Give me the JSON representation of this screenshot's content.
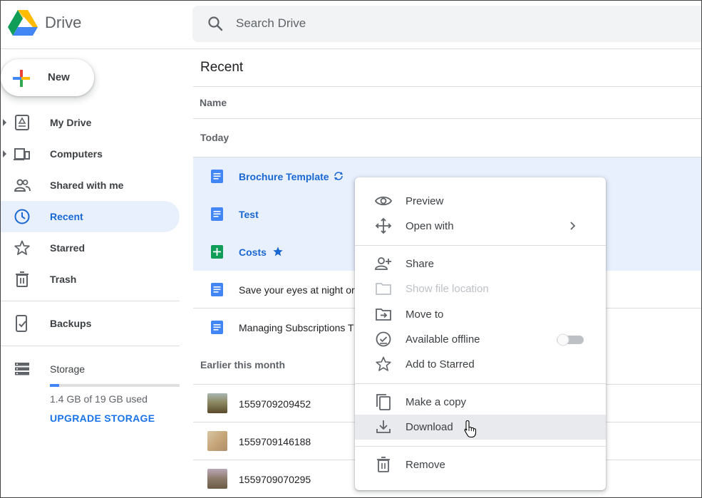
{
  "app": {
    "title": "Drive"
  },
  "search": {
    "placeholder": "Search Drive"
  },
  "sidebar": {
    "new_label": "New",
    "items": [
      {
        "label": "My Drive"
      },
      {
        "label": "Computers"
      },
      {
        "label": "Shared with me"
      },
      {
        "label": "Recent"
      },
      {
        "label": "Starred"
      },
      {
        "label": "Trash"
      },
      {
        "label": "Backups"
      },
      {
        "label": "Storage"
      }
    ],
    "storage_used": "1.4 GB of 19 GB used",
    "storage_fraction": 0.074,
    "upgrade_label": "UPGRADE STORAGE"
  },
  "main": {
    "title": "Recent",
    "column_name": "Name",
    "sections": [
      {
        "label": "Today"
      },
      {
        "label": "Earlier this month"
      }
    ],
    "files": [
      {
        "name": "Brochure Template",
        "type": "doc",
        "selected": true
      },
      {
        "name": "Test",
        "type": "doc",
        "selected": true
      },
      {
        "name": "Costs",
        "type": "sheet",
        "selected": true
      },
      {
        "name": "Save your eyes at night or",
        "type": "doc",
        "selected": false
      },
      {
        "name": "Managing Subscriptions T",
        "type": "doc",
        "selected": false
      },
      {
        "name": "1559709209452",
        "type": "image",
        "selected": false
      },
      {
        "name": "1559709146188",
        "type": "image",
        "selected": false
      },
      {
        "name": "1559709070295",
        "type": "image",
        "selected": false
      }
    ]
  },
  "context_menu": {
    "items": [
      {
        "label": "Preview"
      },
      {
        "label": "Open with"
      },
      {
        "label": "Share"
      },
      {
        "label": "Show file location"
      },
      {
        "label": "Move to"
      },
      {
        "label": "Available offline"
      },
      {
        "label": "Add to Starred"
      },
      {
        "label": "Make a copy"
      },
      {
        "label": "Download"
      },
      {
        "label": "Remove"
      }
    ]
  },
  "colors": {
    "accent": "#1a73e8",
    "selected_bg": "#e8f0fe",
    "doc_icon": "#4285f4",
    "sheet_icon": "#0f9d58"
  },
  "icons": [
    "drive-logo-icon",
    "search-icon",
    "plus-icon",
    "my-drive-icon",
    "computers-icon",
    "shared-icon",
    "clock-icon",
    "star-icon",
    "trash-icon",
    "backups-icon",
    "storage-icon",
    "doc-icon",
    "sheet-icon",
    "sync-icon",
    "eye-icon",
    "move-icon",
    "add-person-icon",
    "folder-icon",
    "move-to-icon",
    "offline-icon",
    "copy-icon",
    "download-icon",
    "pointer-cursor-icon"
  ]
}
